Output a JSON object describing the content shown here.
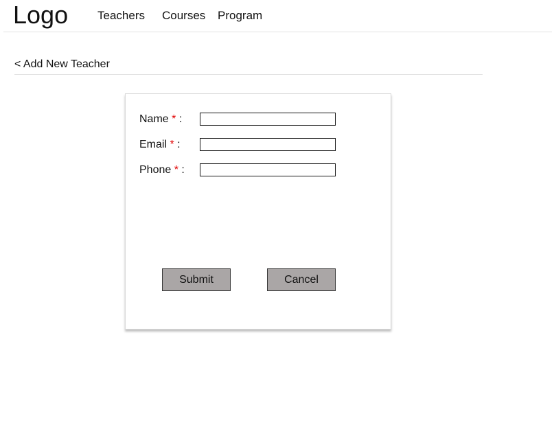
{
  "header": {
    "logo": "Logo",
    "nav": {
      "teachers": "Teachers",
      "courses": "Courses",
      "program": "Program"
    }
  },
  "page": {
    "back_link": "< Add New Teacher"
  },
  "form": {
    "required_mark": "*",
    "separator": ":",
    "fields": {
      "name": {
        "label": "Name",
        "value": "",
        "placeholder": ""
      },
      "email": {
        "label": "Email",
        "value": "",
        "placeholder": ""
      },
      "phone": {
        "label": "Phone",
        "value": "",
        "placeholder": ""
      }
    },
    "submit_label": "Submit",
    "cancel_label": "Cancel"
  },
  "colors": {
    "required": "#e00000",
    "button_bg": "#aaa6a6",
    "divider": "#e2e2e2"
  }
}
